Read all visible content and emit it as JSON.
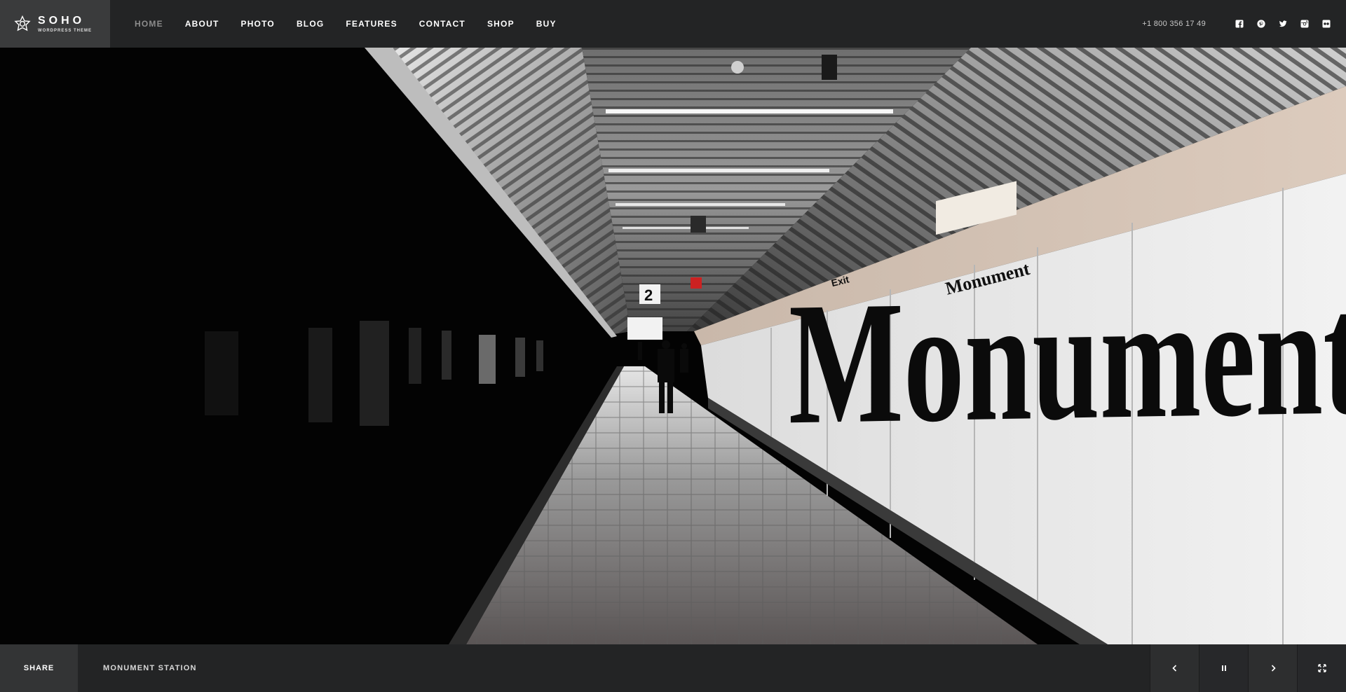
{
  "brand": {
    "title": "SOHO",
    "subtitle": "WORDPRESS THEME"
  },
  "nav": {
    "items": [
      {
        "label": "HOME",
        "active": true
      },
      {
        "label": "ABOUT",
        "active": false
      },
      {
        "label": "PHOTO",
        "active": false
      },
      {
        "label": "BLOG",
        "active": false
      },
      {
        "label": "FEATURES",
        "active": false
      },
      {
        "label": "CONTACT",
        "active": false
      },
      {
        "label": "SHOP",
        "active": false
      },
      {
        "label": "BUY",
        "active": false
      }
    ]
  },
  "header": {
    "phone": "+1 800 356 17 49",
    "socials": [
      "facebook-icon",
      "pinterest-icon",
      "twitter-icon",
      "instagram-icon",
      "flickr-icon"
    ]
  },
  "hero": {
    "wall_text": "Monument",
    "sign_large": "Monument",
    "sign_exit": "Exit",
    "platform_number": "2"
  },
  "footer": {
    "share_label": "SHARE",
    "caption": "MONUMENT STATION",
    "controls": [
      "prev-arrow-icon",
      "pause-icon",
      "next-arrow-icon",
      "fullscreen-icon"
    ]
  },
  "colors": {
    "bar_bg": "#232425",
    "logo_bg": "#3a3b3c",
    "nav_active": "#8c8c8c",
    "text": "#ffffff"
  }
}
